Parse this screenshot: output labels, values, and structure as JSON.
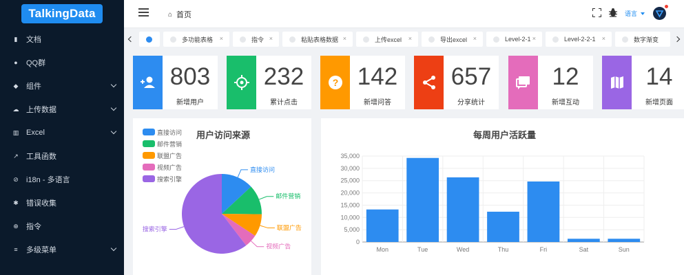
{
  "logo": "TalkingData",
  "sidebar": {
    "items": [
      {
        "label": "文档",
        "icon": "book-icon",
        "chevron": false
      },
      {
        "label": "QQ群",
        "icon": "bell-icon",
        "chevron": false
      },
      {
        "label": "组件",
        "icon": "layers-icon",
        "chevron": true
      },
      {
        "label": "上传数据",
        "icon": "cloud-upload-icon",
        "chevron": true
      },
      {
        "label": "Excel",
        "icon": "bar-chart-icon",
        "chevron": true
      },
      {
        "label": "工具函数",
        "icon": "wrench-icon",
        "chevron": false
      },
      {
        "label": "i18n - 多语言",
        "icon": "translate-icon",
        "chevron": false
      },
      {
        "label": "错误收集",
        "icon": "bug-icon",
        "chevron": false
      },
      {
        "label": "指令",
        "icon": "plus-circle-icon",
        "chevron": false
      },
      {
        "label": "多级菜单",
        "icon": "menu-icon",
        "chevron": true
      }
    ]
  },
  "topbar": {
    "breadcrumb": "首页",
    "language": "语言"
  },
  "tabs": [
    {
      "label": "",
      "active": true
    },
    {
      "label": "多功能表格"
    },
    {
      "label": "指令"
    },
    {
      "label": "粘贴表格数据"
    },
    {
      "label": "上传excel"
    },
    {
      "label": "导出excel"
    },
    {
      "label": "Level-2-1"
    },
    {
      "label": "Level-2-2-1"
    },
    {
      "label": "数字渐变"
    }
  ],
  "cards": [
    {
      "value": "803",
      "label": "新增用户",
      "color": "#2d8cf0",
      "icon": "add-user-icon"
    },
    {
      "value": "232",
      "label": "累计点击",
      "color": "#19be6b",
      "icon": "target-icon"
    },
    {
      "value": "142",
      "label": "新增问答",
      "color": "#ff9900",
      "icon": "question-icon"
    },
    {
      "value": "657",
      "label": "分享统计",
      "color": "#ed3f14",
      "icon": "share-icon"
    },
    {
      "value": "12",
      "label": "新增互动",
      "color": "#e46cbb",
      "icon": "chat-icon"
    },
    {
      "value": "14",
      "label": "新增页面",
      "color": "#9a66e4",
      "icon": "map-icon"
    }
  ],
  "pie": {
    "title": "用户访问来源",
    "legend": [
      "直接访问",
      "邮件营销",
      "联盟广告",
      "视频广告",
      "搜索引擎"
    ]
  },
  "bar": {
    "title": "每周用户活跃量"
  },
  "chart_data": [
    {
      "type": "pie",
      "title": "用户访问来源",
      "categories": [
        "直接访问",
        "邮件营销",
        "联盟广告",
        "视频广告",
        "搜索引擎"
      ],
      "values": [
        335,
        310,
        234,
        135,
        1548
      ],
      "colors": [
        "#2d8cf0",
        "#19be6b",
        "#ff9900",
        "#e46cbb",
        "#9a66e4"
      ],
      "legend": "top-left"
    },
    {
      "type": "bar",
      "title": "每周用户活跃量",
      "categories": [
        "Mon",
        "Tue",
        "Wed",
        "Thu",
        "Fri",
        "Sat",
        "Sun"
      ],
      "values": [
        13253,
        34235,
        26321,
        12340,
        24643,
        1322,
        1324
      ],
      "ylim": [
        0,
        35000
      ],
      "yticks": [
        "0",
        "5,000",
        "10,000",
        "15,000",
        "20,000",
        "25,000",
        "30,000",
        "35,000"
      ],
      "color": "#2d8cf0",
      "grid": true
    }
  ]
}
